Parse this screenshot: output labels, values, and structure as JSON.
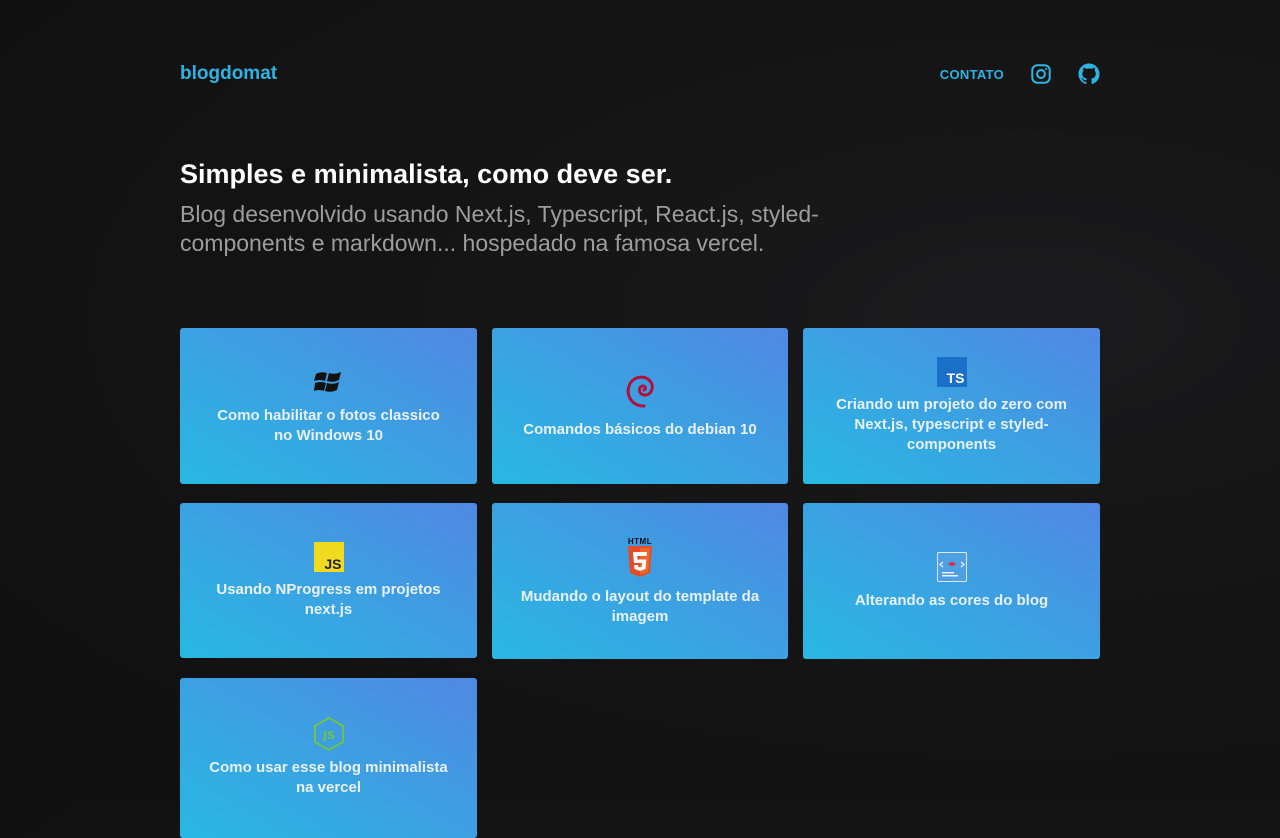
{
  "header": {
    "brand": "blogdomat",
    "nav_contact": "CONTATO",
    "icons": [
      "instagram-icon",
      "github-icon"
    ],
    "accent_color": "#2db4e4"
  },
  "hero": {
    "title": "Simples e minimalista, como deve ser.",
    "subtitle": "Blog desenvolvido usando Next.js, Typescript, React.js, styled-components e markdown... hospedado na famosa vercel."
  },
  "posts": [
    {
      "title": "Como habilitar o fotos classico no Windows 10",
      "icon": "windows-icon"
    },
    {
      "title": "Comandos básicos do debian 10",
      "icon": "debian-icon"
    },
    {
      "title": "Criando um projeto do zero com Next.js, typescript e styled-components",
      "icon": "typescript-icon",
      "icon_text": "TS"
    },
    {
      "title": "Usando NProgress em projetos next.js",
      "icon": "javascript-icon",
      "icon_text": "JS"
    },
    {
      "title": "Mudando o layout do template da imagem",
      "icon": "html5-icon",
      "icon_text": "HTML"
    },
    {
      "title": "Alterando as cores do blog",
      "icon": "styled-components-icon"
    },
    {
      "title": "Como usar esse blog minimalista na vercel",
      "icon": "nodejs-icon",
      "icon_text": "JS"
    }
  ],
  "colors": {
    "card_gradient_start": "#27b8e2",
    "card_gradient_end": "#5088e3",
    "background": "#141414"
  }
}
